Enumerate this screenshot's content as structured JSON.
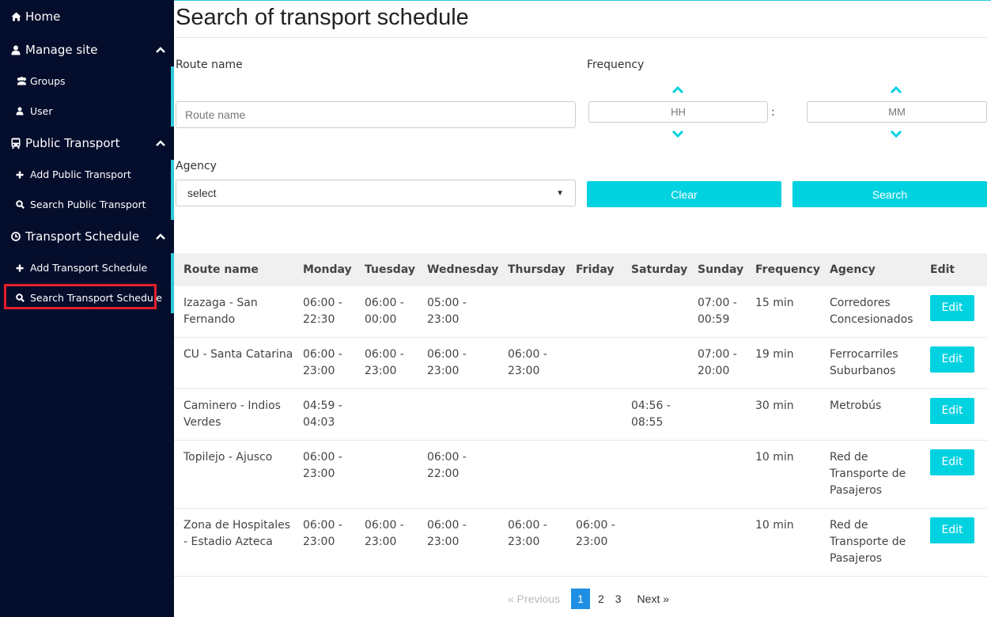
{
  "sidebar": {
    "home": "Home",
    "manage_site": "Manage site",
    "groups": "Groups",
    "user": "User",
    "public_transport": "Public Transport",
    "add_public_transport": "Add Public Transport",
    "search_public_transport": "Search Public Transport",
    "transport_schedule": "Transport Schedule",
    "add_transport_schedule": "Add Transport Schedule",
    "search_transport_schedule": "Search Transport Schedule",
    "active_item": "Search Transport Schedule"
  },
  "page": {
    "title": "Search of transport schedule"
  },
  "form": {
    "route_name_label": "Route name",
    "route_name_placeholder": "Route name",
    "frequency_label": "Frequency",
    "hh_placeholder": "HH",
    "colon": ":",
    "mm_placeholder": "MM",
    "agency_label": "Agency",
    "agency_selected": "select",
    "clear_label": "Clear",
    "search_label": "Search"
  },
  "table": {
    "headers": [
      "Route name",
      "Monday",
      "Tuesday",
      "Wednesday",
      "Thursday",
      "Friday",
      "Saturday",
      "Sunday",
      "Frequency",
      "Agency",
      "Edit"
    ],
    "edit_label": "Edit",
    "rows": [
      {
        "route": "Izazaga - San Fernando",
        "mon": "06:00 - 22:30",
        "tue": "06:00 - 00:00",
        "wed": "05:00 - 23:00",
        "thu": "",
        "fri": "",
        "sat": "",
        "sun": "07:00 - 00:59",
        "freq": "15 min",
        "agency": "Corredores Concesionados"
      },
      {
        "route": "CU - Santa Catarina",
        "mon": "06:00 - 23:00",
        "tue": "06:00 - 23:00",
        "wed": "06:00 - 23:00",
        "thu": "06:00 - 23:00",
        "fri": "",
        "sat": "",
        "sun": "07:00 - 20:00",
        "freq": "19 min",
        "agency": "Ferrocarriles Suburbanos"
      },
      {
        "route": "Caminero - Indios Verdes",
        "mon": "04:59 - 04:03",
        "tue": "",
        "wed": "",
        "thu": "",
        "fri": "",
        "sat": "04:56 - 08:55",
        "sun": "",
        "freq": "30 min",
        "agency": "Metrobús"
      },
      {
        "route": "Topilejo - Ajusco",
        "mon": "06:00 - 23:00",
        "tue": "",
        "wed": "06:00 - 22:00",
        "thu": "",
        "fri": "",
        "sat": "",
        "sun": "",
        "freq": "10 min",
        "agency": "Red de Transporte de Pasajeros"
      },
      {
        "route": "Zona de Hospitales - Estadio Azteca",
        "mon": "06:00 - 23:00",
        "tue": "06:00 - 23:00",
        "wed": "06:00 - 23:00",
        "thu": "06:00 - 23:00",
        "fri": "06:00 - 23:00",
        "sat": "",
        "sun": "",
        "freq": "10 min",
        "agency": "Red de Transporte de Pasajeros"
      }
    ]
  },
  "pagination": {
    "prev_label": "«  Previous",
    "pages": [
      "1",
      "2",
      "3"
    ],
    "current": "1",
    "next_label": "Next  »"
  },
  "colors": {
    "sidebar_bg": "#040d2b",
    "accent": "#00d2e0",
    "active_outline": "#e5202a",
    "page_active": "#1f8fe3"
  }
}
